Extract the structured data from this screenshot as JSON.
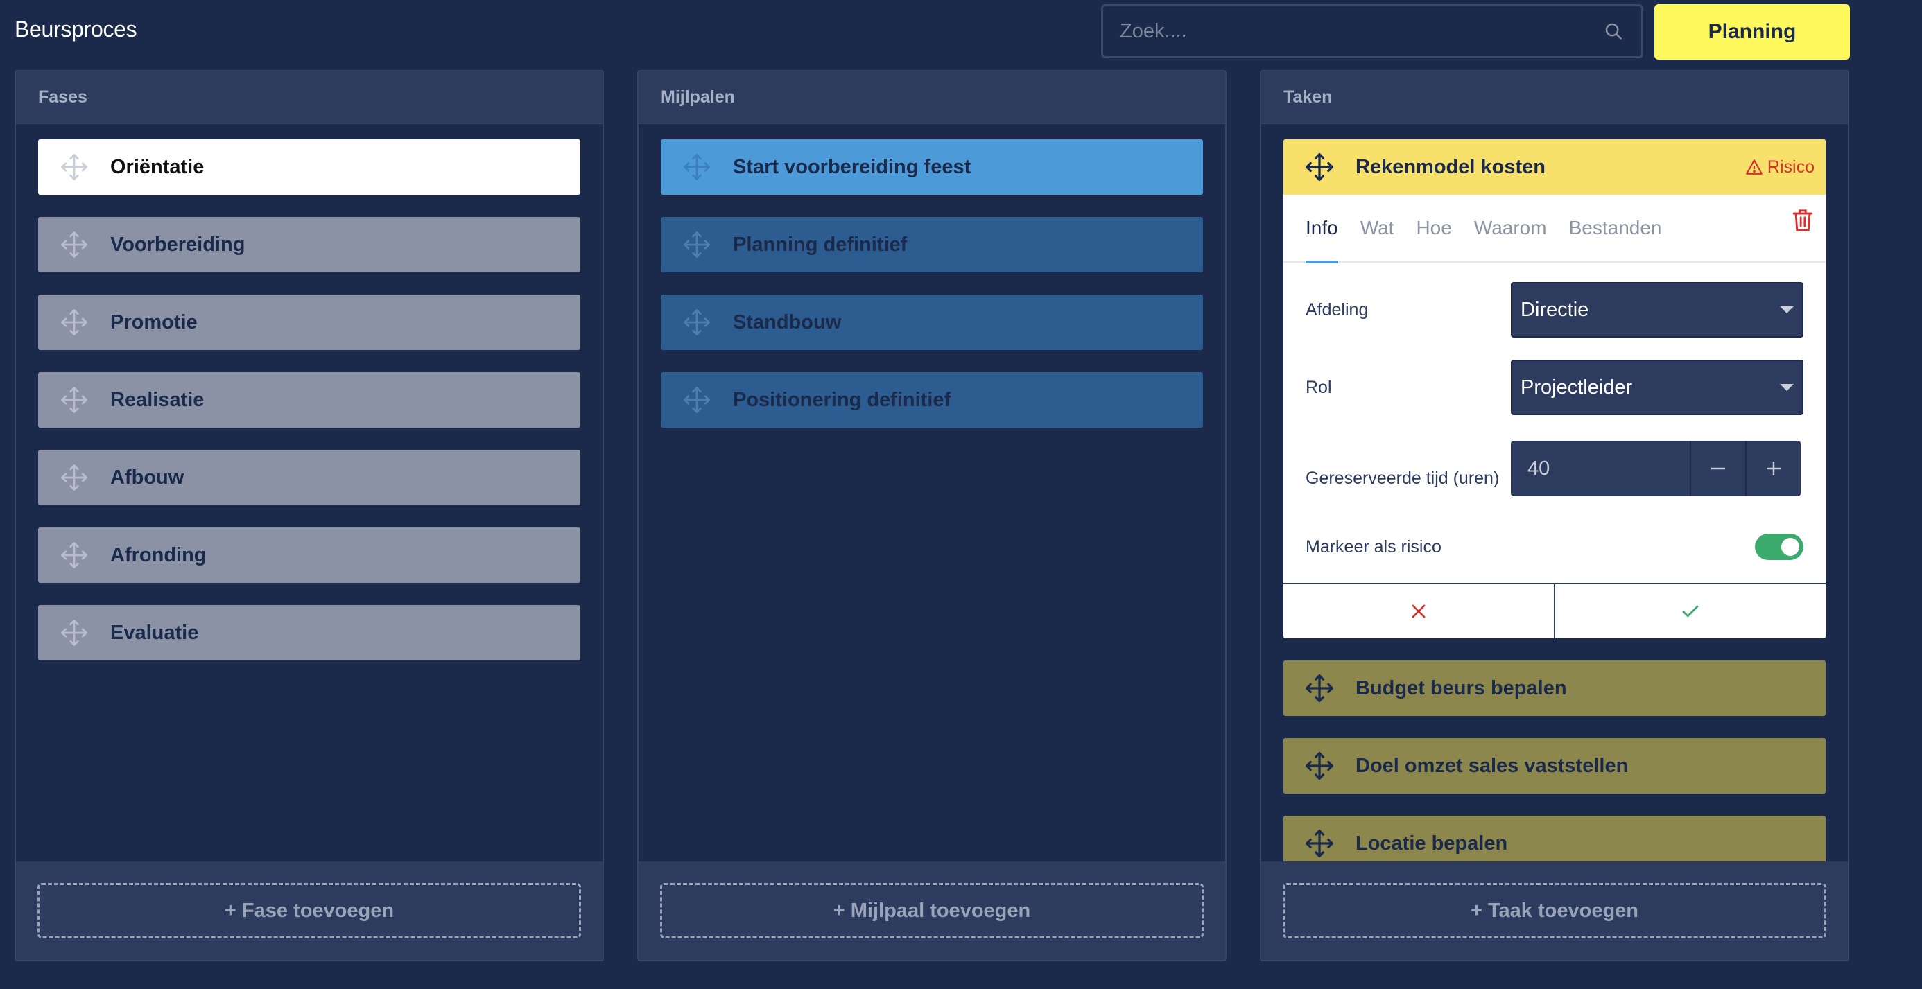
{
  "app": {
    "title": "Beursproces"
  },
  "search": {
    "placeholder": "Zoek...."
  },
  "planning_button": "Planning",
  "fases": {
    "header": "Fases",
    "items": [
      "Oriëntatie",
      "Voorbereiding",
      "Promotie",
      "Realisatie",
      "Afbouw",
      "Afronding",
      "Evaluatie"
    ],
    "active_index": 0,
    "add_label": "+ Fase toevoegen"
  },
  "mijlpalen": {
    "header": "Mijlpalen",
    "items": [
      "Start voorbereiding feest",
      "Planning definitief",
      "Standbouw",
      "Positionering definitief"
    ],
    "active_index": 0,
    "add_label": "+ Mijlpaal toevoegen"
  },
  "taken": {
    "header": "Taken",
    "selected": {
      "title": "Rekenmodel kosten",
      "risk_label": "Risico",
      "tabs": [
        "Info",
        "Wat",
        "Hoe",
        "Waarom",
        "Bestanden"
      ],
      "active_tab": "Info",
      "afdeling_label": "Afdeling",
      "afdeling_value": "Directie",
      "rol_label": "Rol",
      "rol_value": "Projectleider",
      "tijd_label": "Gereserveerde tijd (uren)",
      "tijd_value": "40",
      "risico_label": "Markeer als risico",
      "risico_on": true
    },
    "items": [
      "Budget beurs bepalen",
      "Doel omzet sales vaststellen",
      "Locatie bepalen"
    ],
    "add_label": "+ Taak toevoegen"
  },
  "colors": {
    "background": "#1b2a4a",
    "planning": "#fdf95c",
    "task_selected": "#f8e16a",
    "task": "#8c874d",
    "milestone_active": "#4d9ad9",
    "milestone": "#2d5d90",
    "phase": "#8b92a6",
    "risk": "#d9302c",
    "toggle_on": "#3daa6d"
  },
  "icons": {
    "search": "search-icon",
    "move": "move-icon",
    "warning": "warning-icon",
    "trash": "trash-icon",
    "close": "close-icon",
    "check": "check-icon",
    "minus": "minus-icon",
    "plus": "plus-icon",
    "caret": "caret-down-icon"
  }
}
